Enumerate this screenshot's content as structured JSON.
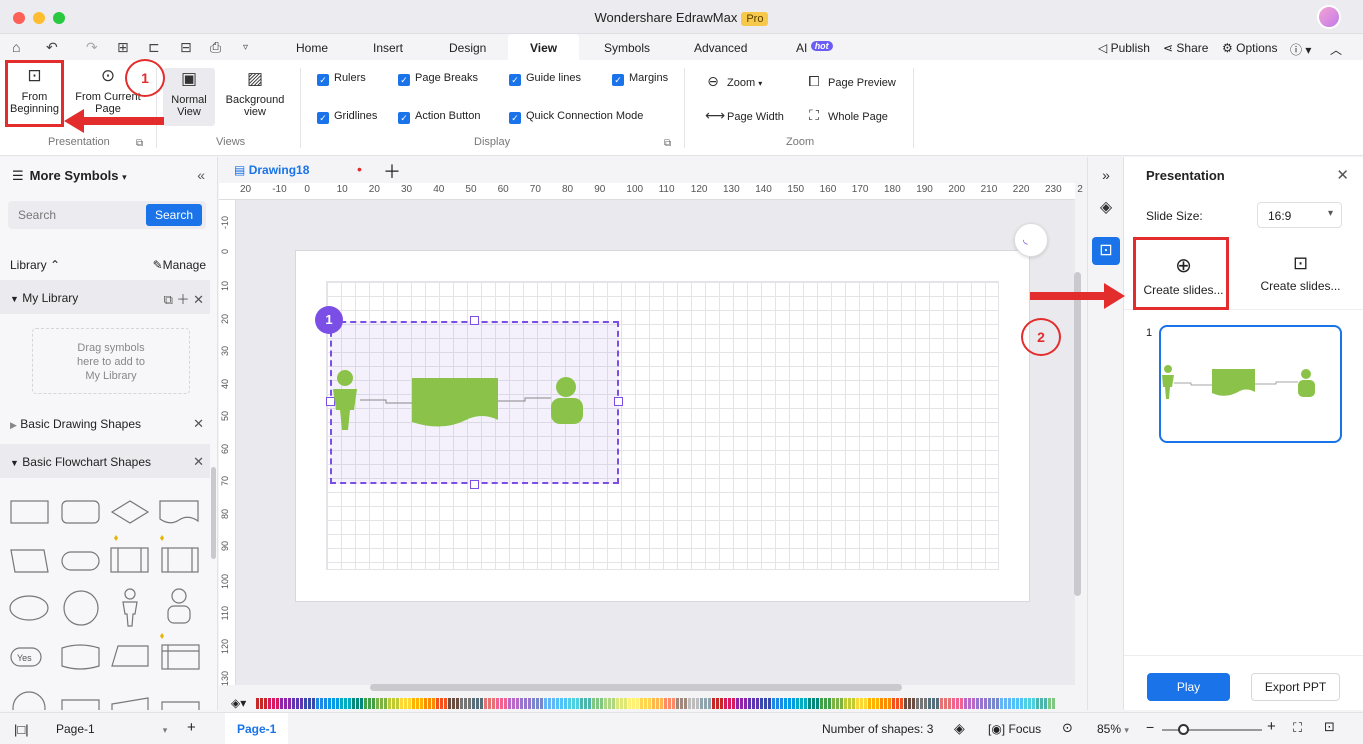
{
  "titlebar": {
    "app_name": "Wondershare EdrawMax",
    "badge": "Pro"
  },
  "menu": {
    "tabs": [
      "Home",
      "Insert",
      "Design",
      "View",
      "Symbols",
      "Advanced",
      "AI"
    ],
    "active_tab": "View",
    "ai_badge": "hot",
    "right": {
      "publish": "Publish",
      "share": "Share",
      "options": "Options"
    }
  },
  "ribbon": {
    "presentation": {
      "from_beginning_line1": "From",
      "from_beginning_line2": "Beginning",
      "from_current": "From Current",
      "from_current_line2": "Page",
      "group_label": "Presentation"
    },
    "views": {
      "normal_line1": "Normal",
      "normal_line2": "View",
      "background_line1": "Background",
      "background_line2": "view",
      "group_label": "Views"
    },
    "display": {
      "rulers": "Rulers",
      "page_breaks": "Page Breaks",
      "guide_lines": "Guide lines",
      "margins": "Margins",
      "gridlines": "Gridlines",
      "action_button": "Action Button",
      "quick_connection": "Quick Connection Mode",
      "group_label": "Display"
    },
    "zoom": {
      "zoom": "Zoom",
      "page_preview": "Page Preview",
      "page_width": "Page Width",
      "whole_page": "Whole Page",
      "group_label": "Zoom"
    }
  },
  "left_panel": {
    "title": "More Symbols",
    "search_placeholder": "Search",
    "search_button": "Search",
    "library_label": "Library",
    "manage_label": "Manage",
    "my_library": "My Library",
    "drag_hint_1": "Drag symbols",
    "drag_hint_2": "here to add to",
    "drag_hint_3": "My Library",
    "basic_drawing": "Basic Drawing Shapes",
    "basic_flowchart": "Basic Flowchart Shapes",
    "yes_shape": "Yes"
  },
  "document": {
    "tab_name": "Drawing18",
    "ruler_h": [
      "20",
      "-10",
      "0",
      "10",
      "20",
      "30",
      "40",
      "50",
      "60",
      "70",
      "80",
      "90",
      "100",
      "110",
      "120",
      "130",
      "140",
      "150",
      "160",
      "170",
      "180",
      "190",
      "200",
      "210",
      "220",
      "230",
      "2"
    ],
    "ruler_v": [
      "-10",
      "0",
      "10",
      "20",
      "30",
      "40",
      "50",
      "60",
      "70",
      "80",
      "90",
      "100",
      "110",
      "120",
      "130"
    ],
    "step_badge": "1"
  },
  "right_panel": {
    "title": "Presentation",
    "slide_size_label": "Slide Size:",
    "slide_size_value": "16:9",
    "create_slides_1": "Create slides...",
    "create_slides_2": "Create slides...",
    "slide_number": "1",
    "play": "Play",
    "export": "Export PPT"
  },
  "statusbar": {
    "page_select": "Page-1",
    "page_tab": "Page-1",
    "shape_count": "Number of shapes: 3",
    "focus": "Focus",
    "zoom": "85%"
  },
  "annotations": {
    "circle1": "1",
    "circle2": "2"
  },
  "colors": {
    "accent": "#1a73e8",
    "selection": "#7b4fe6",
    "shape_green": "#8bc34a",
    "annotation_red": "#e32c2c"
  }
}
